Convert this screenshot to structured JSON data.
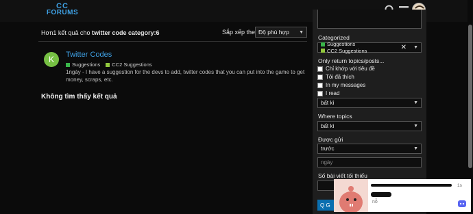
{
  "header": {
    "logo_line1": "CC",
    "logo_line2": "FORUMS"
  },
  "results": {
    "prefix": "Hơn1 kết quả cho ",
    "query": "twitter code category:6",
    "sort_label": "Sắp xếp theo",
    "sort_value": "Độ phù hợp"
  },
  "topic": {
    "avatar_letter": "K",
    "title": "Twitter Codes",
    "categories": [
      {
        "name": "Suggestions",
        "color": "#3ab54a"
      },
      {
        "name": "CC2 Suggestions",
        "color": "#92c83e"
      }
    ],
    "age": "1ngày",
    "excerpt": " - I have a suggestion for the devs to add, twitter codes that you can put into the game to get money, scraps, etc."
  },
  "no_results": "Không tìm thấy kết quả",
  "panel": {
    "categorized_label": "Categorized",
    "categorized_tags": [
      {
        "name": "Suggestions",
        "color": "#3ab54a"
      },
      {
        "name": "CC2 Suggestions",
        "color": "#92c83e"
      }
    ],
    "only_return_label": "Only return topics/posts...",
    "checks": [
      "Chỉ khớp với tiêu đề",
      "Tôi đã thích",
      "In my messages",
      "I read"
    ],
    "only_return_select": "bất kì",
    "where_label": "Where topics",
    "where_select": "bất kì",
    "posted_label": "Được gửi",
    "posted_select": "trước",
    "date_placeholder": "ngày",
    "min_posts_label": "Số bài viết tối thiểu",
    "search_button": "Q G"
  },
  "notification": {
    "time_right": "1s",
    "time_left": "nỗ"
  }
}
